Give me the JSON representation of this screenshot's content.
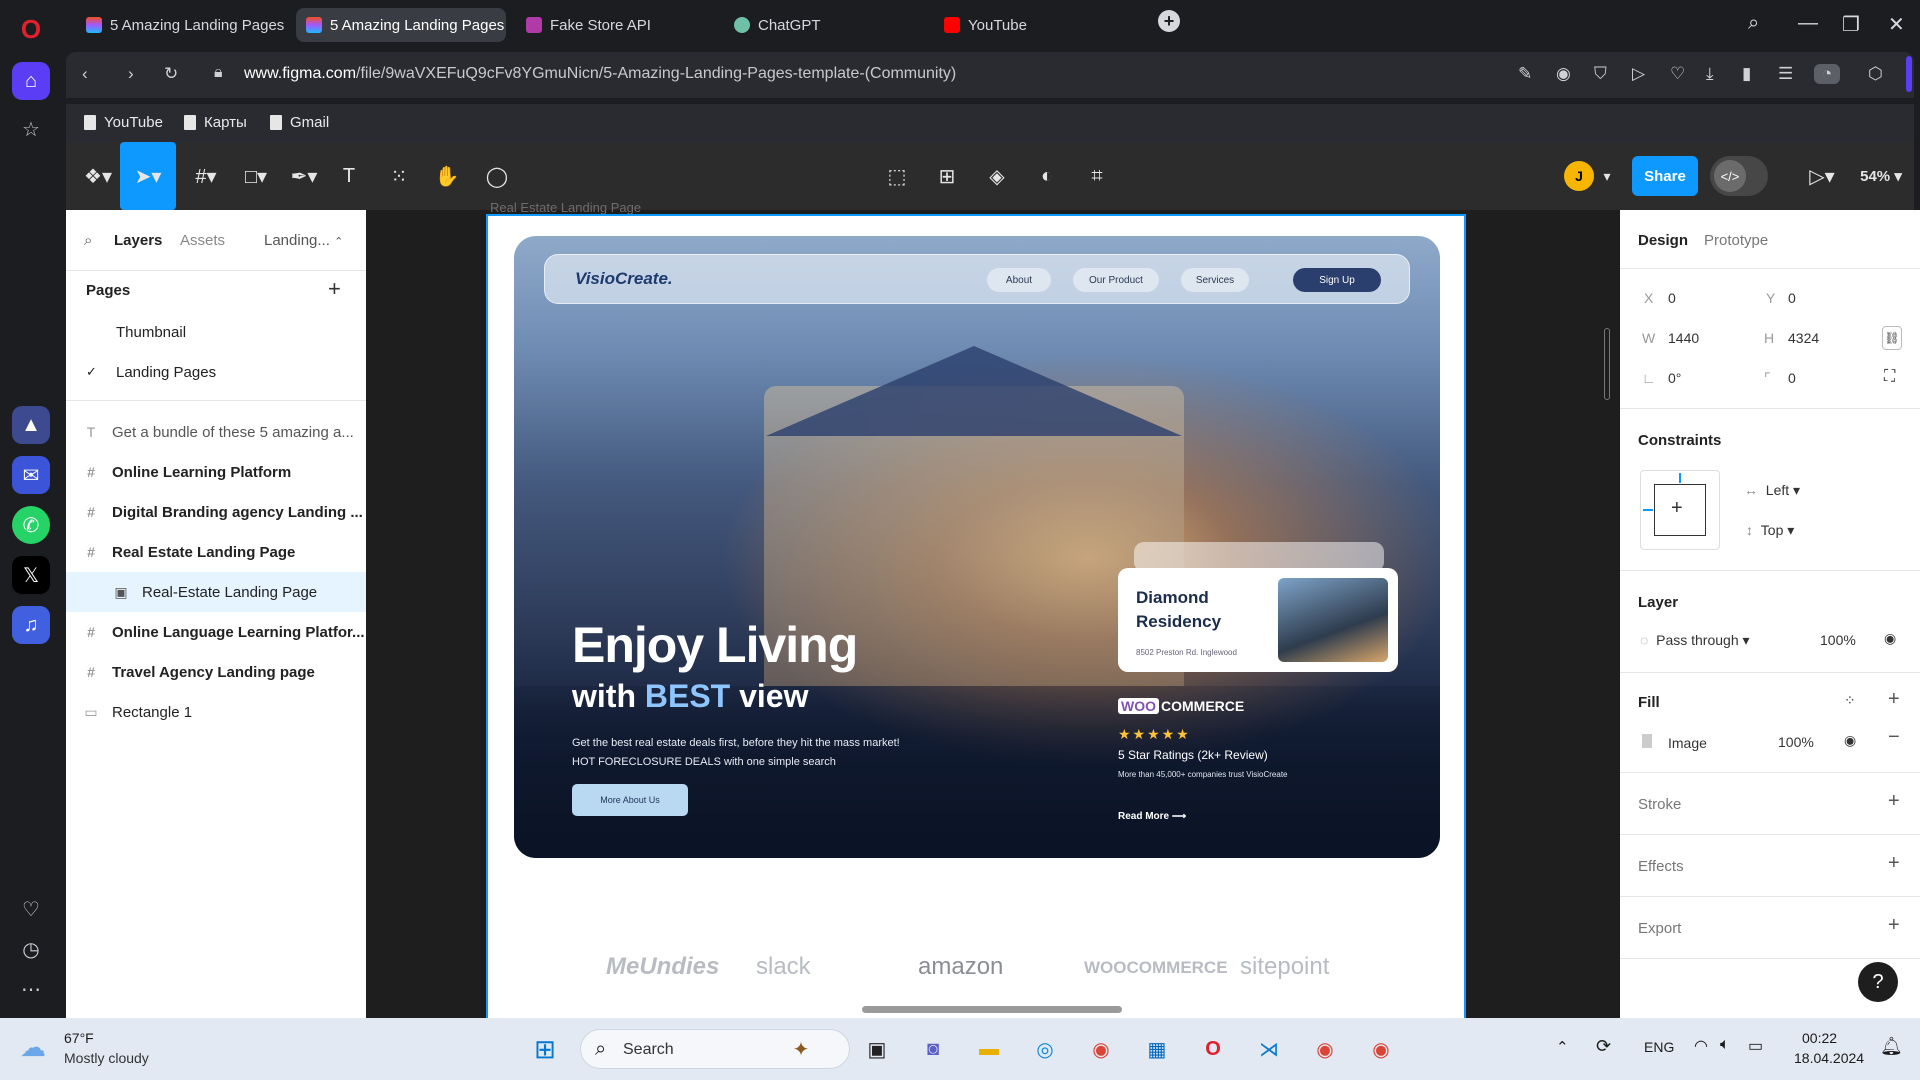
{
  "browser": {
    "tabs": [
      {
        "label": "5 Amazing Landing Pages"
      },
      {
        "label": "5 Amazing Landing Pages"
      },
      {
        "label": "Fake Store API"
      },
      {
        "label": "ChatGPT"
      },
      {
        "label": "YouTube"
      }
    ],
    "url_domain": "www.figma.com",
    "url_path": "/file/9waVXEFuQ9cFv8YGmuNicn/5-Amazing-Landing-Pages-template-(Community)",
    "bookmarks": [
      {
        "label": "YouTube"
      },
      {
        "label": "Карты"
      },
      {
        "label": "Gmail"
      }
    ]
  },
  "figma": {
    "avatar_initial": "J",
    "share_label": "Share",
    "zoom": "54%",
    "left_panel": {
      "tab_layers": "Layers",
      "tab_assets": "Assets",
      "page_switcher": "Landing...",
      "pages_title": "Pages",
      "pages": [
        {
          "label": "Thumbnail"
        },
        {
          "label": "Landing Pages"
        }
      ],
      "layers": [
        {
          "label": "Get a bundle of these 5 amazing a..."
        },
        {
          "label": "Online Learning Platform"
        },
        {
          "label": "Digital Branding agency Landing ..."
        },
        {
          "label": "Real Estate Landing Page"
        },
        {
          "label": "Real-Estate Landing Page"
        },
        {
          "label": "Online Language Learning Platfor..."
        },
        {
          "label": "Travel Agency Landing page"
        },
        {
          "label": "Rectangle 1"
        }
      ]
    },
    "canvas": {
      "frame_label": "Real Estate Landing Page",
      "hero": {
        "logo": "VisioCreate.",
        "nav": [
          "About",
          "Our Product",
          "Services",
          "Sign Up"
        ],
        "headline": "Enjoy Living",
        "subheadline_pre": "with ",
        "subheadline_accent": "BEST",
        "subheadline_post": " view",
        "paragraph": "Get the best real estate deals first, before they hit the mass market! HOT FORECLOSURE DEALS with one simple search",
        "cta": "More About Us",
        "card_title": "Diamond Residency",
        "card_address": "8502 Preston Rd. Inglewood",
        "woo_badge": "WOO",
        "woo_text": "COMMERCE",
        "stars": "★★★★★",
        "ratings": "5 Star Ratings (2k+ Review)",
        "trust": "More than 45,000+ companies trust VisioCreate",
        "read_more": "Read More ⟶"
      },
      "brands": [
        "MeUndies",
        "slack",
        "amazon",
        "WOOCOMMERCE",
        "sitepoint"
      ]
    },
    "right_panel": {
      "tab_design": "Design",
      "tab_prototype": "Prototype",
      "x_label": "X",
      "x": "0",
      "y_label": "Y",
      "y": "0",
      "w_label": "W",
      "w": "1440",
      "h_label": "H",
      "h": "4324",
      "rotation": "0°",
      "radius": "0",
      "constraints_title": "Constraints",
      "constraint_h": "Left",
      "constraint_v": "Top",
      "layer_title": "Layer",
      "blend": "Pass through",
      "layer_opacity": "100%",
      "fill_title": "Fill",
      "fill_type": "Image",
      "fill_opacity": "100%",
      "stroke_title": "Stroke",
      "effects_title": "Effects",
      "export_title": "Export"
    }
  },
  "taskbar": {
    "weather_temp": "67°F",
    "weather_desc": "Mostly cloudy",
    "search": "Search",
    "lang": "ENG",
    "time": "00:22",
    "date": "18.04.2024"
  },
  "colors": {
    "figma_blue": "#0d99ff",
    "opera_red": "#e0202d"
  }
}
